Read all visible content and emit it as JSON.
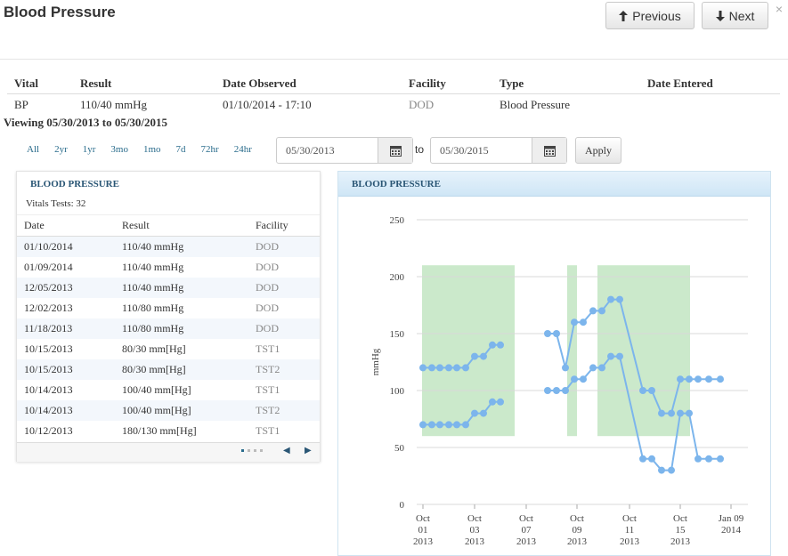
{
  "header": {
    "title": "Blood Pressure",
    "close_label": "×",
    "prev_label": "Previous",
    "next_label": "Next"
  },
  "summary": {
    "columns": [
      "Vital",
      "Result",
      "Date Observed",
      "Facility",
      "Type",
      "Date Entered"
    ],
    "row": [
      "BP",
      "110/40 mmHg",
      "01/10/2014 - 17:10",
      "DOD",
      "Blood Pressure",
      ""
    ]
  },
  "viewing": "Viewing 05/30/2013 to 05/30/2015",
  "filters": {
    "ranges": [
      "All",
      "2yr",
      "1yr",
      "3mo",
      "1mo",
      "7d",
      "72hr",
      "24hr"
    ],
    "from_date": "05/30/2013",
    "to_label": "to",
    "to_date": "05/30/2015",
    "apply_label": "Apply"
  },
  "list_panel": {
    "title": "BLOOD PRESSURE",
    "subtitle": "Vitals Tests: 32",
    "columns": [
      "Date",
      "Result",
      "Facility"
    ],
    "rows": [
      [
        "01/10/2014",
        "110/40 mmHg",
        "DOD"
      ],
      [
        "01/09/2014",
        "110/40 mmHg",
        "DOD"
      ],
      [
        "12/05/2013",
        "110/40 mmHg",
        "DOD"
      ],
      [
        "12/02/2013",
        "110/80 mmHg",
        "DOD"
      ],
      [
        "11/18/2013",
        "110/80 mmHg",
        "DOD"
      ],
      [
        "10/15/2013",
        "80/30 mm[Hg]",
        "TST1"
      ],
      [
        "10/15/2013",
        "80/30 mm[Hg]",
        "TST2"
      ],
      [
        "10/14/2013",
        "100/40 mm[Hg]",
        "TST1"
      ],
      [
        "10/14/2013",
        "100/40 mm[Hg]",
        "TST2"
      ],
      [
        "10/12/2013",
        "180/130 mm[Hg]",
        "TST1"
      ]
    ],
    "prev_icon": "chevron-left-icon",
    "next_icon": "chevron-right-icon"
  },
  "chart_panel": {
    "title": "BLOOD PRESSURE"
  },
  "chart_data": {
    "type": "line",
    "ylabel": "mmHg",
    "ylim": [
      0,
      250
    ],
    "yticks": [
      0,
      50,
      100,
      150,
      200,
      250
    ],
    "x_tick_labels": [
      [
        "Oct",
        "01",
        "2013"
      ],
      [
        "Oct",
        "03",
        "2013"
      ],
      [
        "Oct",
        "07",
        "2013"
      ],
      [
        "Oct",
        "09",
        "2013"
      ],
      [
        "Oct",
        "11",
        "2013"
      ],
      [
        "Oct",
        "15",
        "2013"
      ],
      [
        "Jan 09",
        "2014"
      ]
    ],
    "shaded_band": [
      60,
      210
    ],
    "series": [
      {
        "values": [
          120,
          120,
          120,
          120,
          120,
          120,
          130,
          130,
          140,
          140,
          null,
          150,
          150,
          120,
          160,
          160,
          170,
          170,
          180,
          180,
          100,
          100,
          80,
          80,
          110,
          110,
          110,
          110,
          110
        ]
      },
      {
        "values": [
          70,
          70,
          70,
          70,
          70,
          70,
          80,
          80,
          90,
          90,
          null,
          100,
          100,
          100,
          110,
          110,
          120,
          120,
          130,
          130,
          40,
          40,
          30,
          30,
          80,
          80,
          40,
          40,
          40
        ]
      }
    ],
    "colors": {
      "line": "#7cb5ec",
      "band": "#cbe9cb",
      "grid": "#d8d8d8"
    }
  }
}
